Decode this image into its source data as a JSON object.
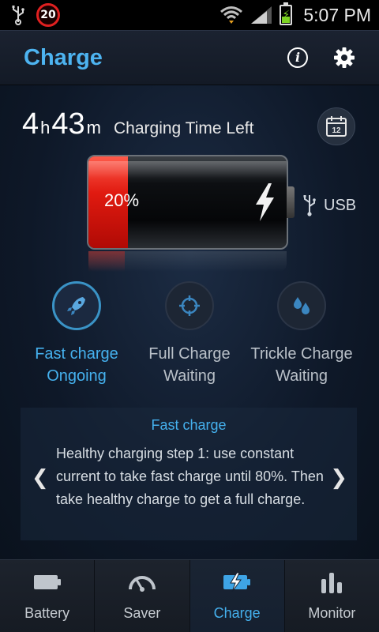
{
  "status_bar": {
    "notification_count": "20",
    "time": "5:07 PM",
    "icons": [
      "usb-icon",
      "notification-badge",
      "wifi-icon",
      "signal-icon",
      "battery-charging-icon"
    ]
  },
  "header": {
    "title": "Charge",
    "icons": [
      "info-icon",
      "settings-gear-icon"
    ]
  },
  "charge": {
    "time_hours": "4",
    "time_h_unit": "h",
    "time_minutes": "43",
    "time_m_unit": "m",
    "time_label": "Charging Time Left",
    "calendar_day": "12",
    "battery_percent": 20,
    "battery_label": "20%",
    "source_label": "USB"
  },
  "steps": [
    {
      "name": "Fast charge",
      "status": "Ongoing",
      "icon": "rocket-icon",
      "active": true
    },
    {
      "name": "Full Charge",
      "status": "Waiting",
      "icon": "cycle-icon",
      "active": false
    },
    {
      "name": "Trickle Charge",
      "status": "Waiting",
      "icon": "droplets-icon",
      "active": false
    }
  ],
  "info": {
    "title": "Fast charge",
    "text": "Healthy charging step 1: use constant current to take fast charge until 80%. Then take healthy charge to get a full charge."
  },
  "bottom_nav": {
    "items": [
      {
        "label": "Battery",
        "icon": "battery-icon",
        "active": false
      },
      {
        "label": "Saver",
        "icon": "speedometer-icon",
        "active": false
      },
      {
        "label": "Charge",
        "icon": "charge-bolt-battery-icon",
        "active": true
      },
      {
        "label": "Monitor",
        "icon": "bar-chart-icon",
        "active": false
      }
    ]
  },
  "colors": {
    "accent": "#45b1ee",
    "battery_red": "#e01a10",
    "status_green": "#7dd322"
  }
}
